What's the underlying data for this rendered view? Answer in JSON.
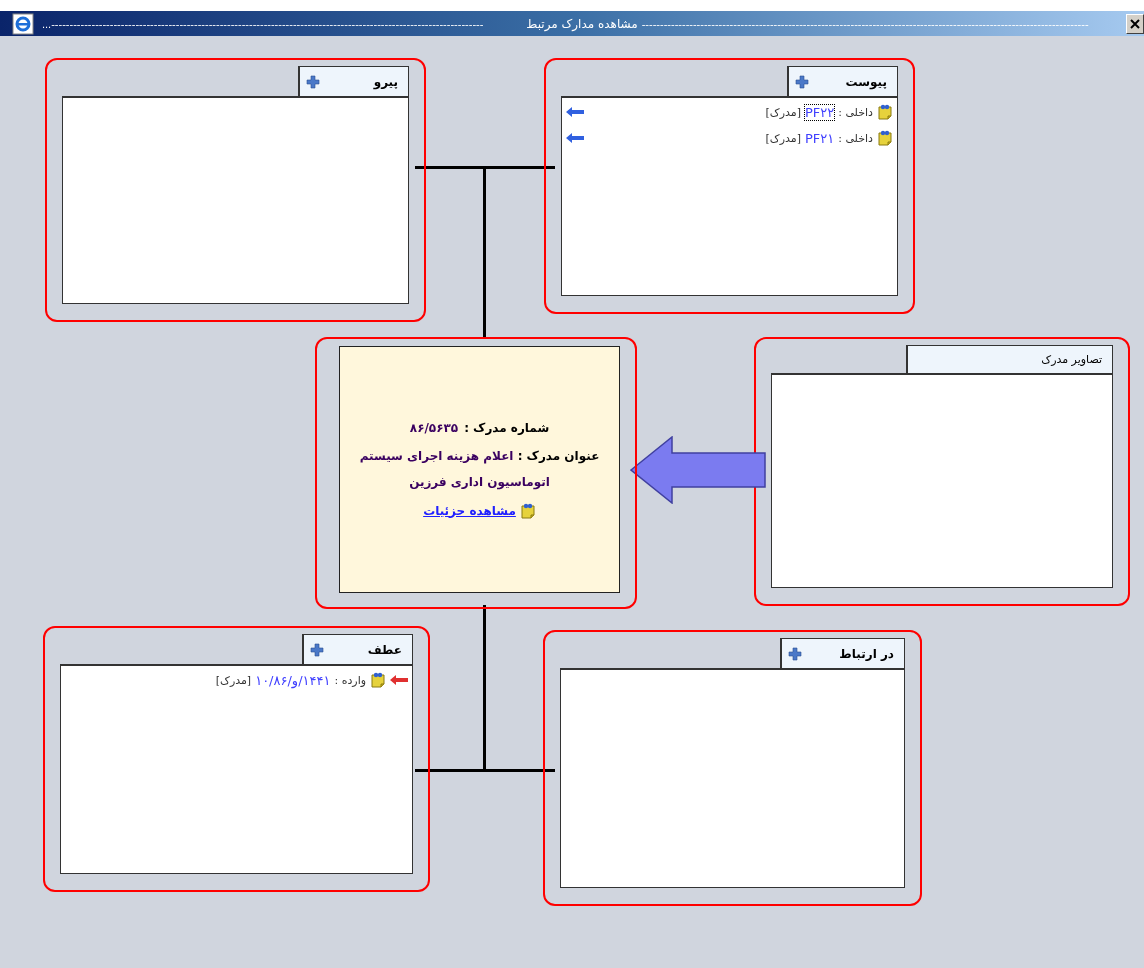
{
  "window": {
    "title": "مشاهده مدارک مرتبط",
    "right_dashes": "--------------------------------------------------------------------------------------------------------------------------",
    "left_dashes": "...----------------------------------------------------------------------------------------------------------------------"
  },
  "panels": [
    {
      "title": "پیوست",
      "add_button": true,
      "items": [
        {
          "kind": "outgoing",
          "label": "داخلی :",
          "code": "PF۲۲",
          "tag": "[مدرک]",
          "focused": true
        },
        {
          "kind": "outgoing",
          "label": "داخلی :",
          "code": "PF۲۱",
          "tag": "[مدرک]",
          "focused": false
        }
      ]
    },
    {
      "title": "پیرو",
      "add_button": true
    },
    {
      "title": "تصاویر مدرک",
      "add_button": false
    },
    {
      "title": "در ارتباط",
      "add_button": true
    },
    {
      "title": "عطف",
      "add_button": true,
      "items": [
        {
          "kind": "incoming",
          "label": "وارده :",
          "code": "۱۴۴۱/و/۱۰/۸۶",
          "tag": "[مدرک]",
          "focused": false
        }
      ]
    }
  ],
  "document": {
    "number_label": "شماره مدرک :",
    "number": "۸۶/۵۶۳۵",
    "title_label": "عنوان مدرک :",
    "title": "اعلام هزینه اجرای سیستم اتوماسیون اداری فرزین",
    "details_link": "مشاهده جزئیات"
  }
}
